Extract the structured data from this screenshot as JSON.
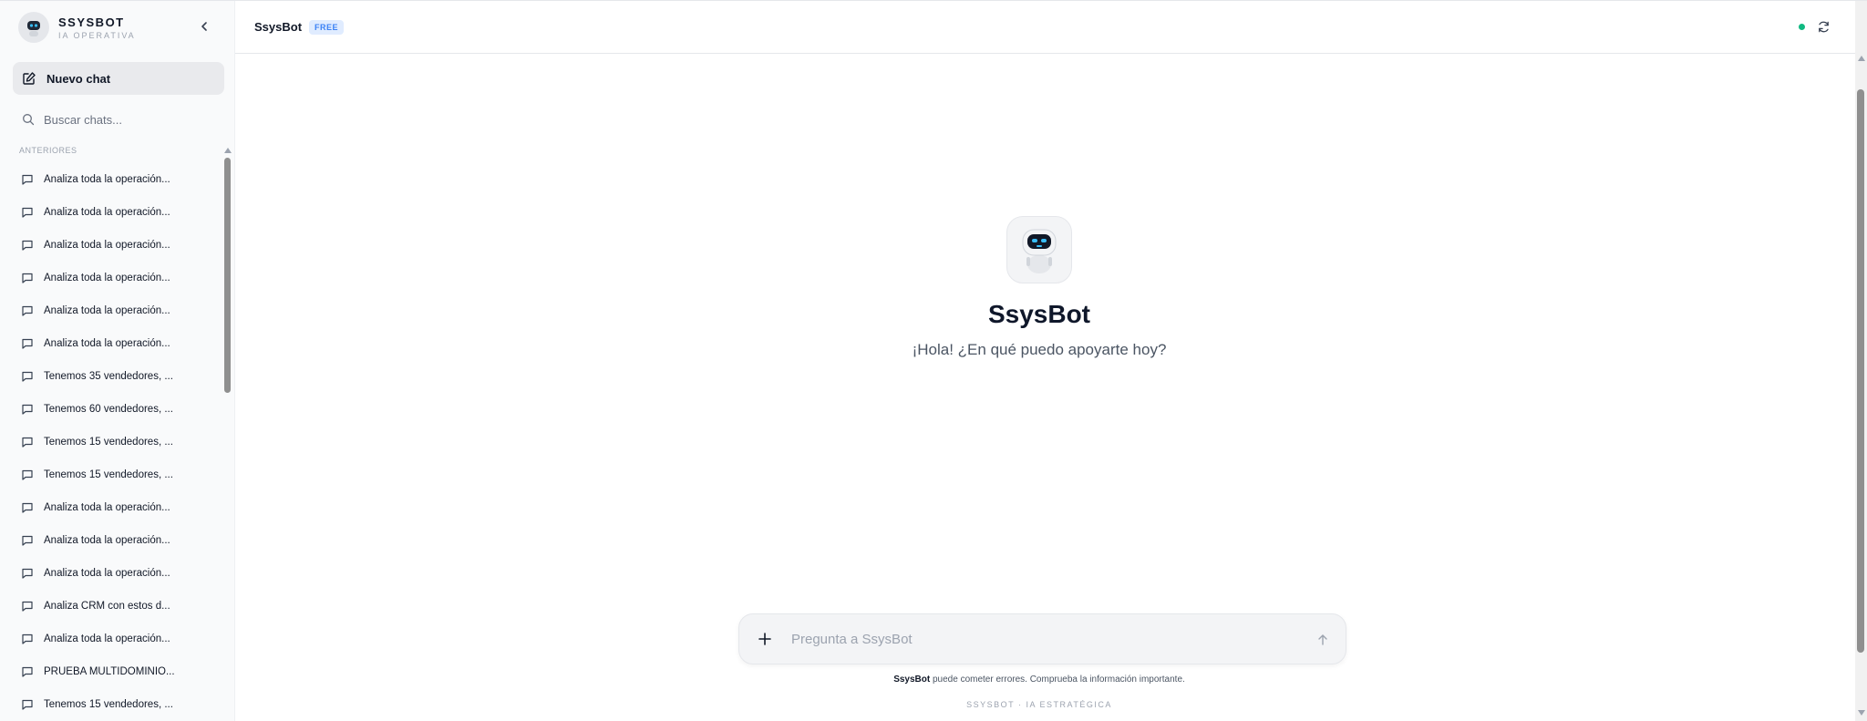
{
  "sidebar": {
    "brand_name": "SSYSBOT",
    "brand_subtitle": "IA OPERATIVA",
    "new_chat_label": "Nuevo chat",
    "search_label": "Buscar chats...",
    "section_label": "ANTERIORES",
    "chats": [
      "Analiza toda la operación...",
      "Analiza toda la operación...",
      "Analiza toda la operación...",
      "Analiza toda la operación...",
      "Analiza toda la operación...",
      "Analiza toda la operación...",
      "Tenemos 35 vendedores, ...",
      "Tenemos 60 vendedores, ...",
      "Tenemos 15 vendedores, ...",
      "Tenemos 15 vendedores, ...",
      "Analiza toda la operación...",
      "Analiza toda la operación...",
      "Analiza toda la operación...",
      "Analiza CRM con estos d...",
      "Analiza toda la operación...",
      "PRUEBA MULTIDOMINIO...",
      "Tenemos 15 vendedores, ..."
    ]
  },
  "header": {
    "title": "SsysBot",
    "badge": "FREE",
    "status_color": "#10b981"
  },
  "hero": {
    "title": "SsysBot",
    "subtitle": "¡Hola! ¿En qué puedo apoyarte hoy?"
  },
  "composer": {
    "placeholder": "Pregunta a SsysBot"
  },
  "footer": {
    "disclaimer_brand": "SsysBot",
    "disclaimer_text": " puede cometer errores. Comprueba la información importante.",
    "brand_line": "SSYSBOT · IA ESTRATÉGICA"
  },
  "icons": {
    "collapse": "chevron-left-icon",
    "new_chat": "edit-icon",
    "search": "search-icon",
    "chat": "message-square-icon",
    "refresh": "refresh-icon",
    "plus": "plus-icon",
    "send": "arrow-up-icon"
  }
}
